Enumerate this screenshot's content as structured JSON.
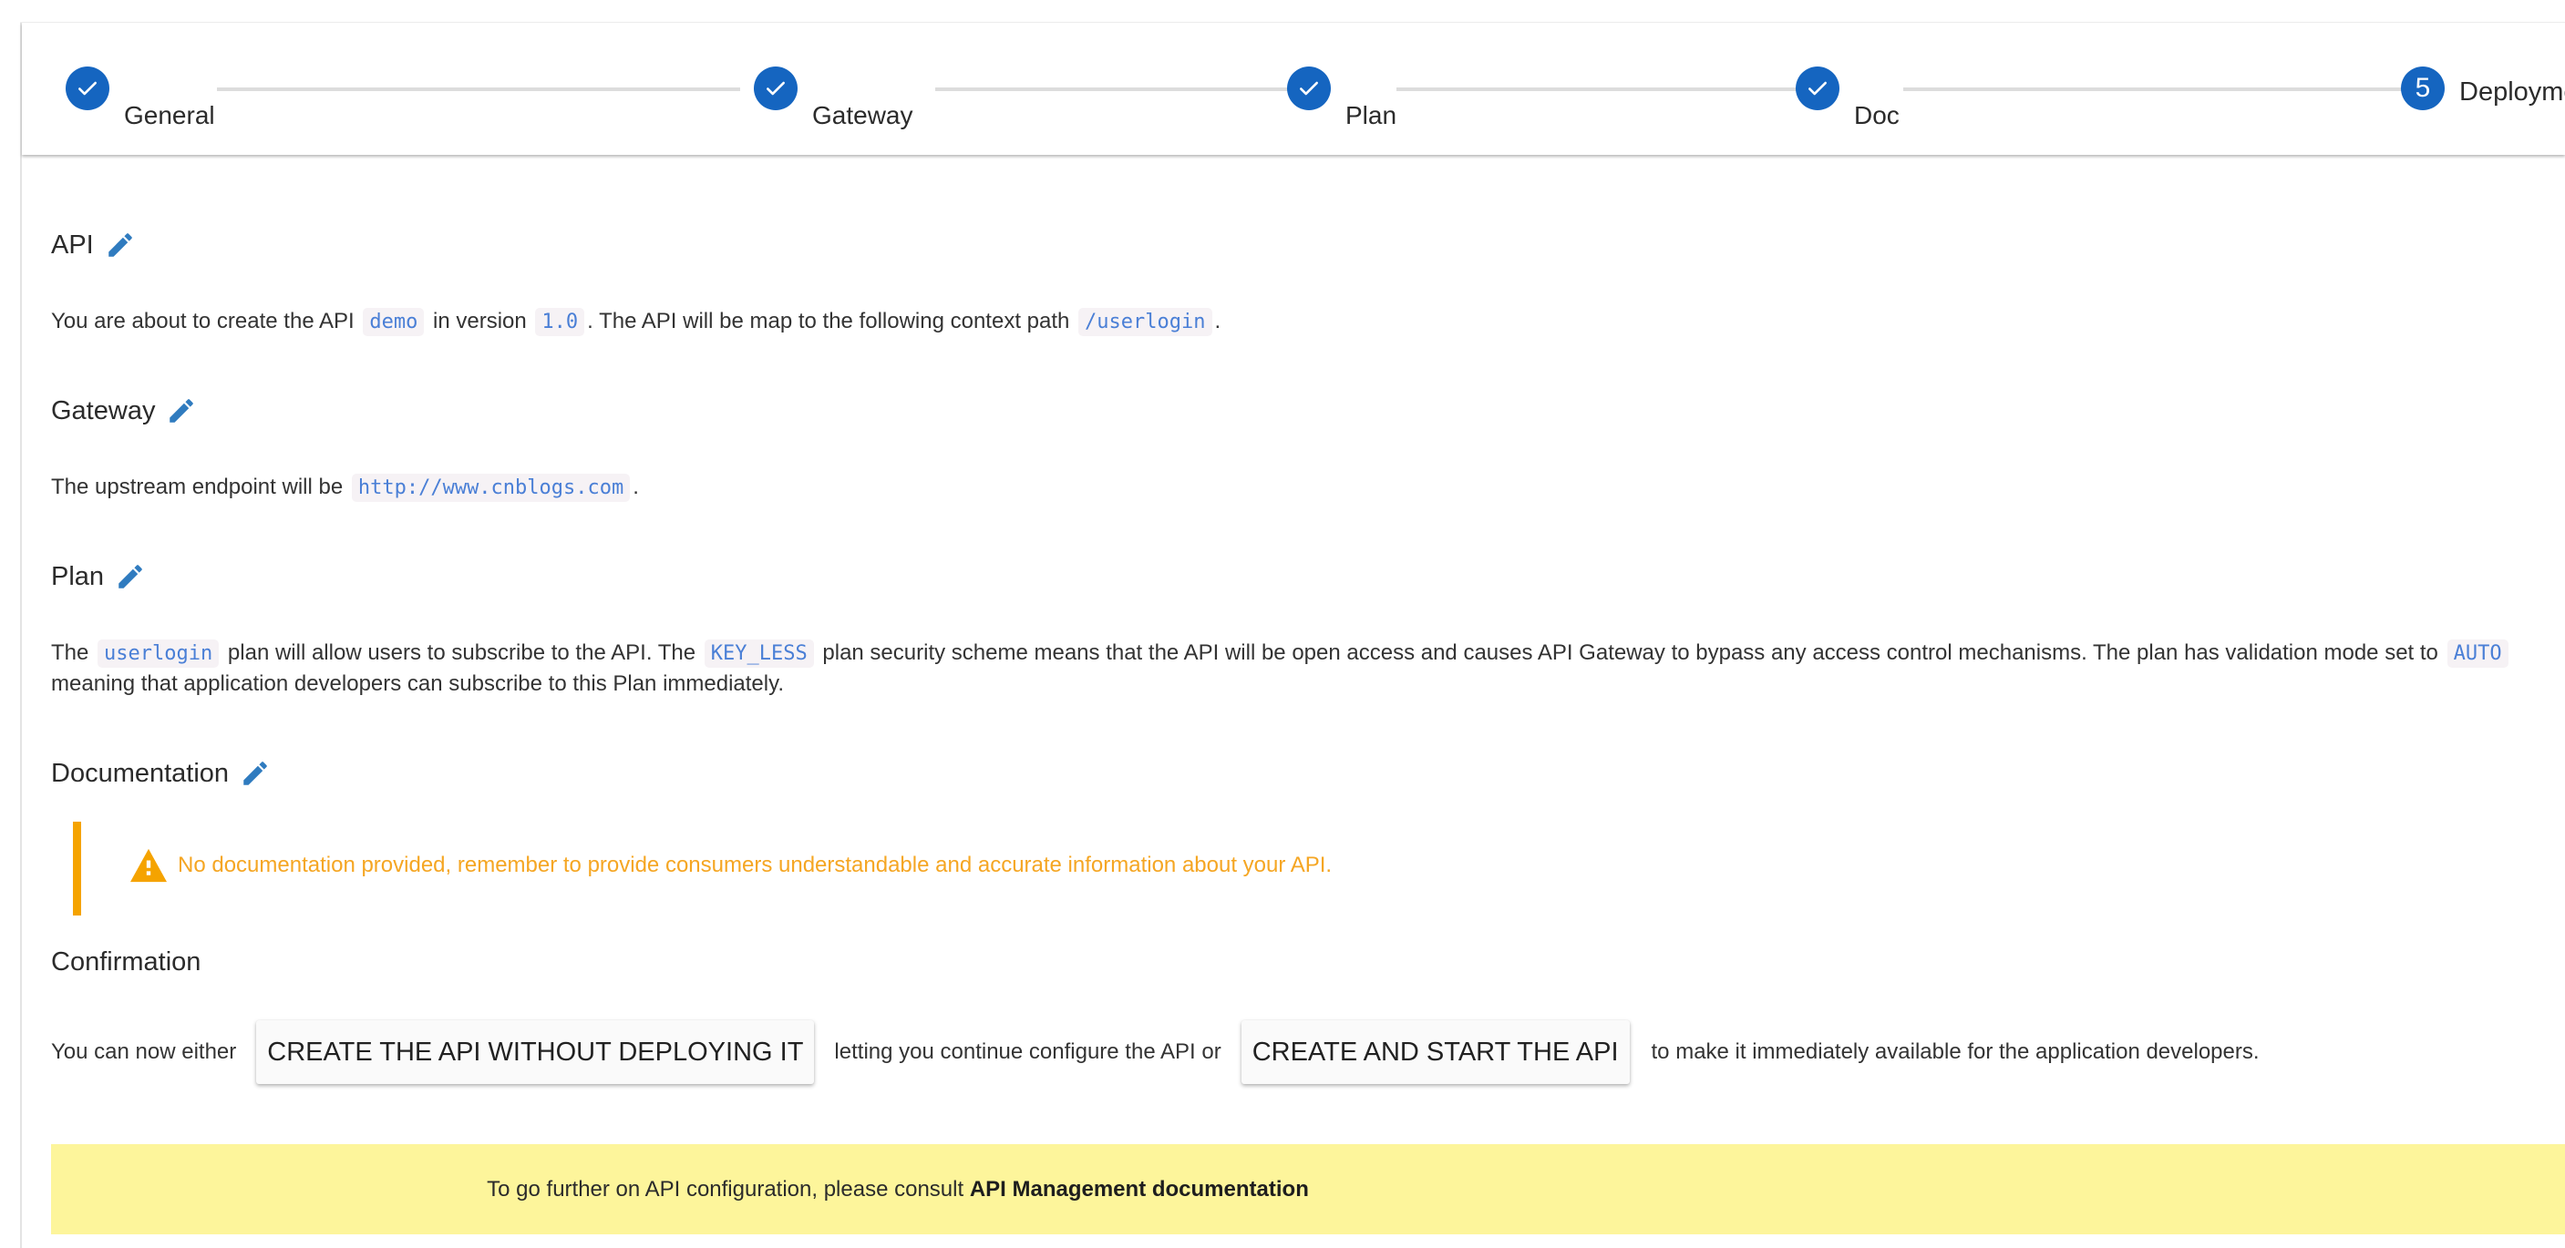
{
  "stepper": {
    "steps": [
      {
        "label": "General",
        "status": "completed",
        "icon": "check-icon"
      },
      {
        "label": "Gateway",
        "status": "completed",
        "icon": "check-icon"
      },
      {
        "label": "Plan",
        "status": "completed",
        "icon": "check-icon"
      },
      {
        "label": "Doc",
        "status": "completed",
        "icon": "check-icon"
      },
      {
        "label": "Deployment",
        "status": "active",
        "number": "5"
      }
    ]
  },
  "colors": {
    "primary": "#1565c0",
    "edit_icon": "#2f7bbf",
    "code_text": "#4a7fd6",
    "warning": "#f5a623",
    "footer_bg": "#fdf59b"
  },
  "sections": {
    "api": {
      "title": "API",
      "edit_icon": "pencil-icon",
      "text_1": "You are about to create the API",
      "name": "demo",
      "text_2": "in version",
      "version": "1.0",
      "text_3": ". The API will be map to the following context path",
      "context_path": "/userlogin",
      "text_4": "."
    },
    "gateway": {
      "title": "Gateway",
      "edit_icon": "pencil-icon",
      "text_1": "The upstream endpoint will be",
      "endpoint": "http://www.cnblogs.com",
      "text_2": "."
    },
    "plan": {
      "title": "Plan",
      "edit_icon": "pencil-icon",
      "text_1": "The",
      "plan_name": "userlogin",
      "text_2": "plan will allow users to subscribe to the API. The",
      "security": "KEY_LESS",
      "text_3": "plan security scheme means that the API will be open access and causes API Gateway to bypass any access control mechanisms. The plan has validation mode set to",
      "validation": "AUTO",
      "text_4": "meaning that application developers can subscribe to this Plan immediately."
    },
    "documentation": {
      "title": "Documentation",
      "edit_icon": "pencil-icon",
      "warning_icon": "warning-icon",
      "warning": "No documentation provided, remember to provide consumers understandable and accurate information about your API."
    },
    "confirmation": {
      "title": "Confirmation",
      "text_1": "You can now either",
      "button_create": "CREATE THE API WITHOUT DEPLOYING IT",
      "text_2": "letting you continue configure the API or",
      "button_create_start": "CREATE AND START THE API",
      "text_3": "to make it immediately available for the application developers."
    }
  },
  "footer": {
    "text": "To go further on API configuration, please consult ",
    "link": "API Management documentation"
  }
}
